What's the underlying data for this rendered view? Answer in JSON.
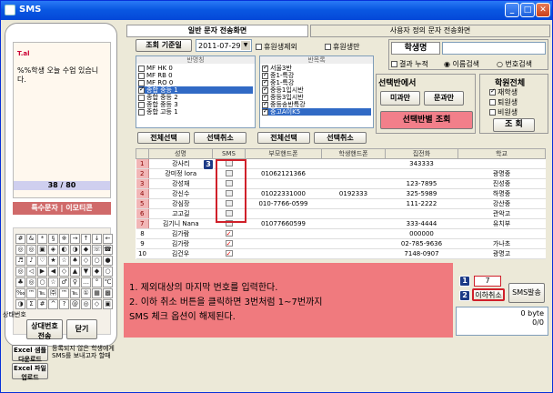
{
  "window": {
    "title": "SMS"
  },
  "tabs": [
    "일반 문자 전송화면",
    "사용자 정의 문자 전송화면"
  ],
  "phone": {
    "carrier_icon": "signal-icon",
    "message": "%%학생 오늘 수업 있습니다.",
    "counter": "38 / 80",
    "special_button": "특수문자 | 이모티콘",
    "keys": [
      "#",
      "&",
      "*",
      "§",
      "※",
      "→",
      "↑",
      "↓",
      "←",
      "◎",
      "◎",
      "▣",
      "◈",
      "◐",
      "◑",
      "◆",
      "☏",
      "☎",
      "♬",
      "♪",
      "♡",
      "★",
      "☆",
      "♠",
      "◇",
      "○",
      "●",
      "◎",
      "◁",
      "▶",
      "◀",
      "◇",
      "▲",
      "▼",
      "◆",
      "○",
      "♣",
      "◎",
      "○",
      "☆",
      "♂",
      "♀",
      "…",
      "°",
      "℃",
      "‰",
      "™",
      "℡",
      "㈜",
      "™",
      "℡",
      "①",
      "▦",
      "▩",
      "◑",
      "Σ",
      "#",
      "^",
      "?",
      "@",
      "◎",
      "◇",
      "▣"
    ],
    "status_label": "상태번호",
    "send_button": "상대번호 전송",
    "close_button": "닫기",
    "excel_download": "Excel 샘플 다운로드",
    "excel_upload": "Excel 파일 업로드",
    "excel_note": "등록되지 않은 학생에게 SMS를 보내고자 할때"
  },
  "filters": {
    "date_label": "조회 기준일",
    "date_value": "2011-07-29",
    "exclude_leave": "휴원생제외",
    "leave_only": "휴원생만",
    "student_name_label": "학생명",
    "result_accum": "결과 누적",
    "sort_name": "이름검색",
    "sort_number": "번호검색"
  },
  "class_list": {
    "header": "반명칭",
    "items": [
      "MF HK 0",
      "MF RB 0",
      "MF RO 0",
      "종합 중등 1",
      "종합 중등 2",
      "종합 중등 3",
      "종합 고등 1"
    ],
    "checked": [
      false,
      false,
      false,
      true,
      false,
      false,
      false
    ],
    "selected_index": 3
  },
  "subject_list": {
    "header": "반목록",
    "items": [
      "서울3반",
      "중1-특강",
      "중1-특강",
      "중등1입시반",
      "중등3입시반",
      "중등송반특강",
      "중고A이K5"
    ],
    "checked": [
      true,
      true,
      true,
      true,
      true,
      true,
      true
    ]
  },
  "select_buttons": {
    "all1": "전체선택",
    "cancel1": "선택취소",
    "all2": "전체선택",
    "cancel2": "선택취소"
  },
  "selection": {
    "title": "선택반에서",
    "btn_a": "미과만",
    "btn_b": "문과만",
    "btn_query": "선택반별 조회"
  },
  "academy": {
    "title": "학원전체",
    "enrolled": "재학생",
    "withdrawn": "퇴원생",
    "leave": "비원생",
    "search": "조 회"
  },
  "table": {
    "columns": [
      "성명",
      "SMS",
      "부모핸드폰",
      "학생핸드폰",
      "집전화",
      "학교"
    ],
    "rows": [
      {
        "n": "1",
        "name": "강사리",
        "sms": false,
        "parent": "",
        "student": "",
        "home": "343333",
        "school": ""
      },
      {
        "n": "2",
        "name": "강미정 lora",
        "sms": false,
        "parent": "01062121366",
        "student": "",
        "home": "",
        "school": "광명중"
      },
      {
        "n": "3",
        "name": "강성재",
        "sms": false,
        "parent": "",
        "student": "",
        "home": "123-7895",
        "school": "진성중"
      },
      {
        "n": "4",
        "name": "강신수",
        "sms": false,
        "parent": "01022331000",
        "student": "0192333",
        "home": "325-5989",
        "school": "하명중"
      },
      {
        "n": "5",
        "name": "강심장",
        "sms": false,
        "parent": "010-7766-0599",
        "student": "",
        "home": "111-2222",
        "school": "강산중"
      },
      {
        "n": "6",
        "name": "고고길",
        "sms": false,
        "parent": "",
        "student": "",
        "home": "",
        "school": "관악고"
      },
      {
        "n": "7",
        "name": "김기니 Nana",
        "sms": false,
        "parent": "01077660599",
        "student": "",
        "home": "333-4444",
        "school": "유치부"
      },
      {
        "n": "8",
        "name": "김가람",
        "sms": true,
        "parent": "",
        "student": "",
        "home": "000000",
        "school": ""
      },
      {
        "n": "9",
        "name": "김가랑",
        "sms": true,
        "parent": "",
        "student": "",
        "home": "02-785-9636",
        "school": "가나초"
      },
      {
        "n": "10",
        "name": "김건우",
        "sms": true,
        "parent": "",
        "student": "",
        "home": "7148-0907",
        "school": "광명고"
      }
    ]
  },
  "annotation": {
    "line1": "1. 제외대상의 마지막 번호를 입력한다.",
    "line2": "2. 이하 취소 버튼을 클릭하면 3번처럼 1~7번까지",
    "line3": "    SMS 체크 옵션이 해제된다."
  },
  "callouts": {
    "one": "1",
    "two": "2",
    "three": "3"
  },
  "bottom": {
    "exclude_value": "7",
    "cancel_below": "이하취소",
    "sms_send": "SMS발송",
    "bytes": "0 byte",
    "progress": "0/0"
  }
}
